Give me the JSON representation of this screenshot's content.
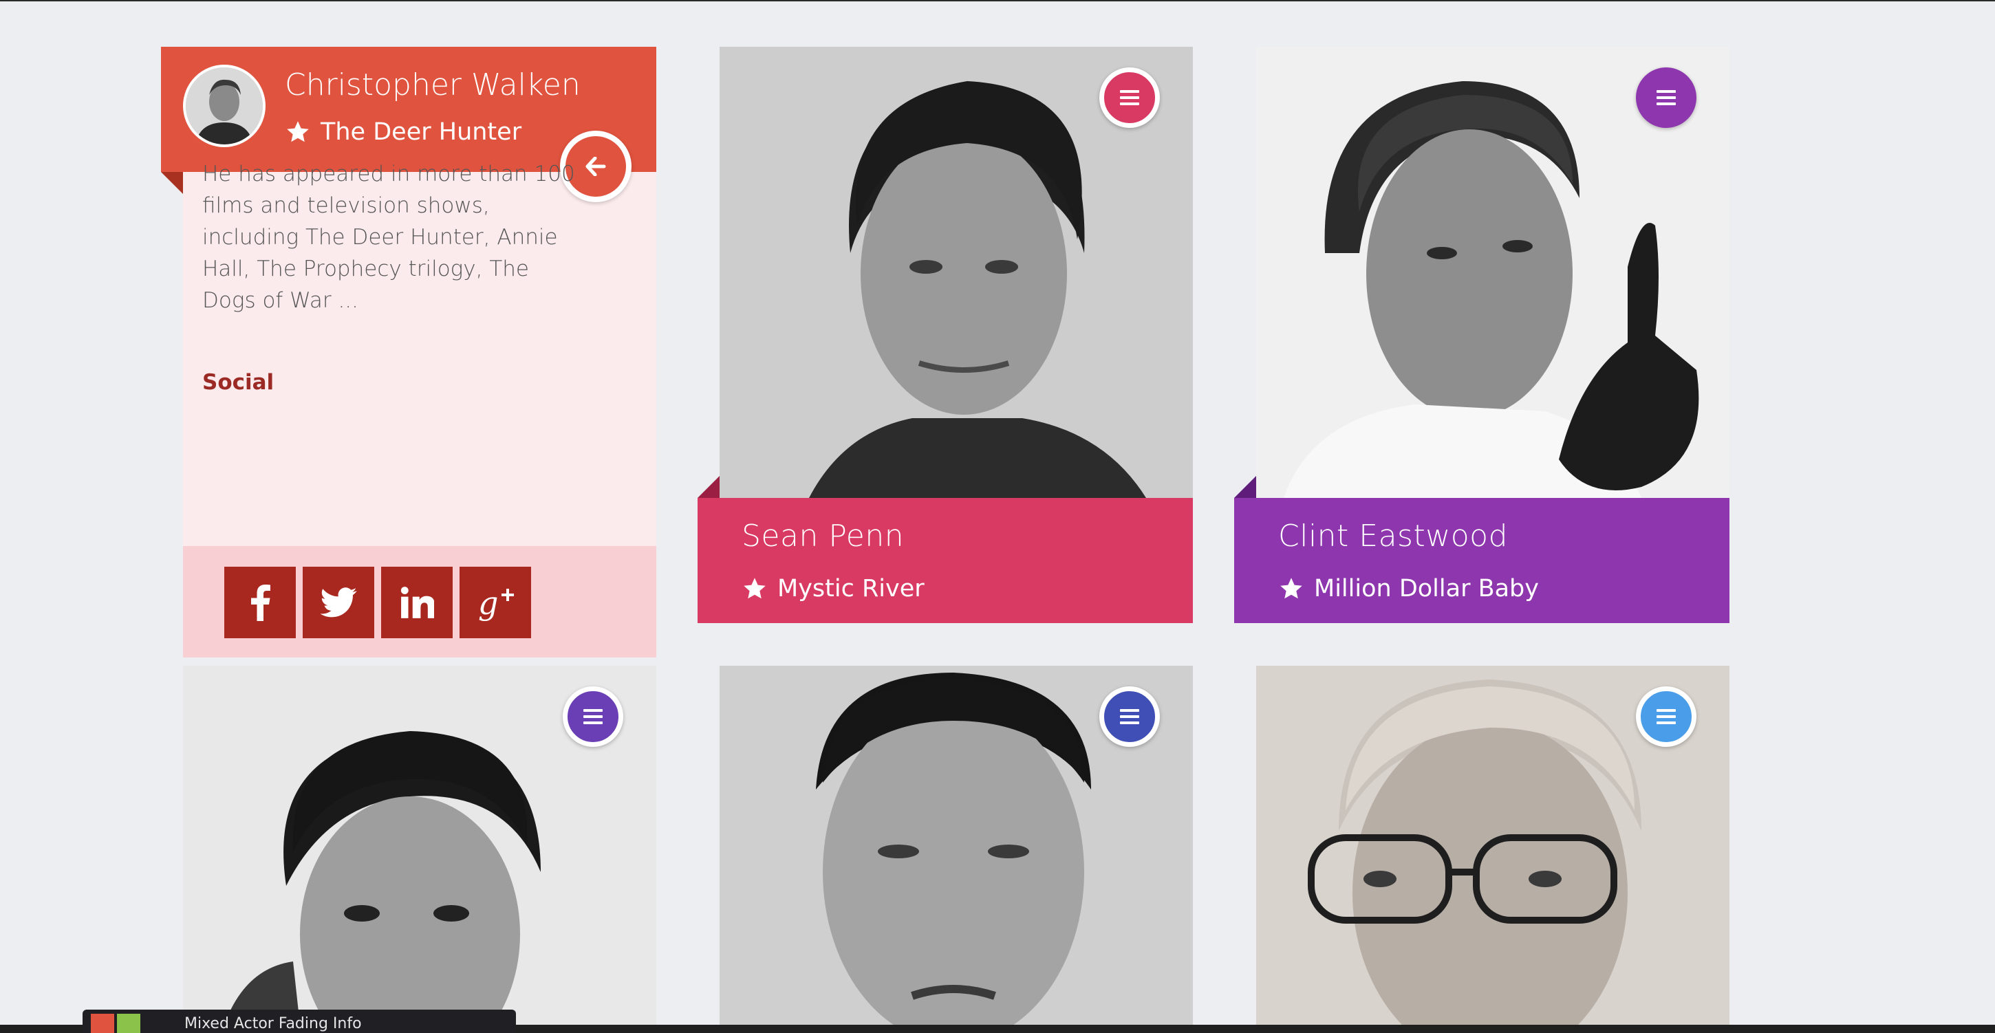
{
  "expanded_card": {
    "name": "Christopher Walken",
    "movie": "The Deer Hunter",
    "bio": "He has appeared in more than 100 films and television shows, including The Deer Hunter, Annie Hall, The Prophecy trilogy, The Dogs of War ...",
    "social_title": "Social",
    "social_icons": [
      "facebook-icon",
      "twitter-icon",
      "linkedin-icon",
      "google-plus-icon"
    ],
    "color": "#e0533e"
  },
  "cards": [
    {
      "name": "Sean Penn",
      "movie": "Mystic River",
      "color": "#d93a63",
      "fold_color": "#9a1f43"
    },
    {
      "name": "Clint Eastwood",
      "movie": "Million Dollar Baby",
      "color": "#8e36ad",
      "fold_color": "#5f1c7a"
    },
    {
      "name": "",
      "movie": "",
      "color": "#6a3fb5",
      "fold_color": "#46248a"
    },
    {
      "name": "",
      "movie": "",
      "color": "#3f4fb5",
      "fold_color": "#28337f"
    },
    {
      "name": "",
      "movie": "",
      "color": "#4a9de8",
      "fold_color": "#2b70b3"
    }
  ],
  "taskbar": {
    "label": "Mixed Actor Fading Info"
  }
}
